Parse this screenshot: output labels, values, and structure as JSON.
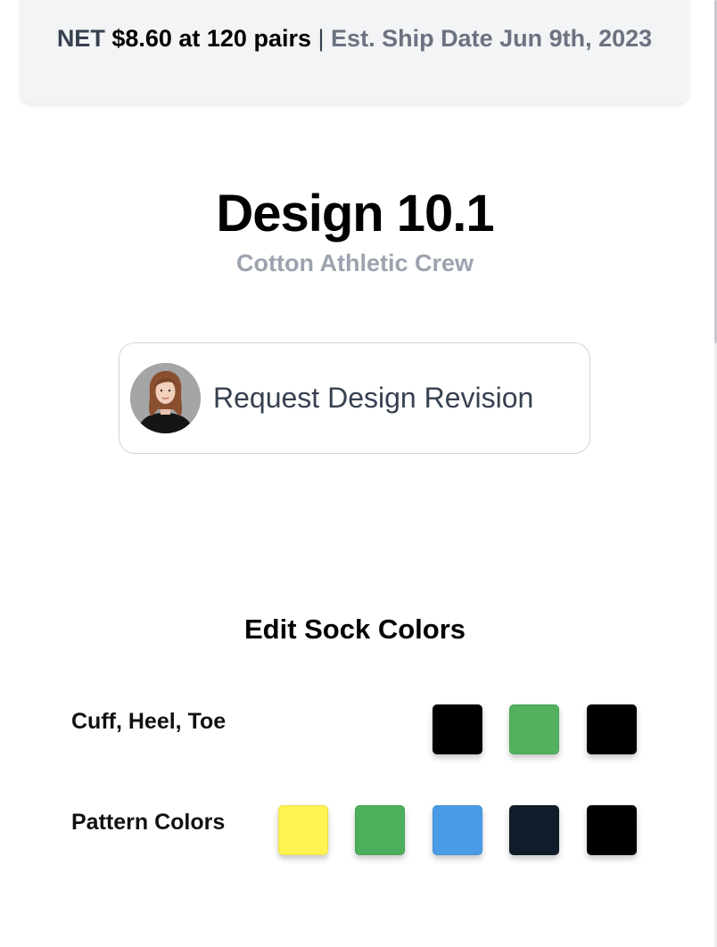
{
  "header": {
    "net_label": "NET",
    "price": "$8.60 at 120 pairs",
    "separator": "|",
    "ship_date": "Est. Ship Date Jun 9th, 2023"
  },
  "design": {
    "title": "Design 10.1",
    "subtitle": "Cotton Athletic Crew"
  },
  "revision": {
    "label": "Request Design Revision"
  },
  "colors_section": {
    "title": "Edit Sock Colors",
    "rows": [
      {
        "label": "Cuff, Heel, Toe",
        "swatches": [
          "#000000",
          "#52b05f",
          "#000000"
        ]
      },
      {
        "label": "Pattern Colors",
        "swatches": [
          "#fff44f",
          "#4caf5b",
          "#4a9ce8",
          "#101c2a",
          "#000000"
        ]
      }
    ]
  }
}
